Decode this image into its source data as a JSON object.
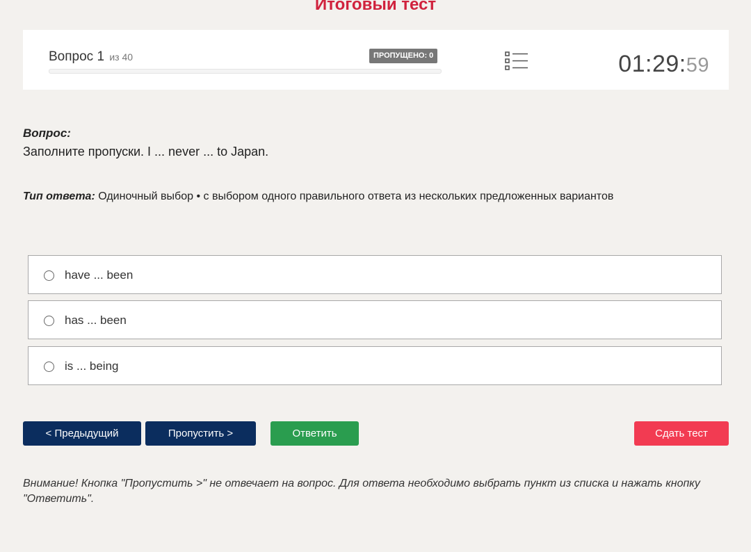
{
  "page": {
    "title": "Итоговый тест"
  },
  "header": {
    "question_word": "Вопрос",
    "question_number": "1",
    "of_total": "из 40",
    "skipped_badge": "ПРОПУЩЕНО: 0",
    "progress_fraction": 0,
    "list_icon": "list-icon",
    "timer_main": "01:29:",
    "timer_seconds": "59"
  },
  "question": {
    "label": "Вопрос:",
    "text": "Заполните пропуски. I ... never ... to Japan.",
    "answer_type_label": "Тип ответа:",
    "answer_type_text": "Одиночный выбор • с выбором одного правильного ответа из нескольких предложенных вариантов"
  },
  "options": [
    {
      "label": "have ... been",
      "selected": false
    },
    {
      "label": "has ... been",
      "selected": false
    },
    {
      "label": "is ... being",
      "selected": false
    }
  ],
  "buttons": {
    "prev": "< Предыдущий",
    "skip": "Пропустить >",
    "answer": "Ответить",
    "finish": "Сдать тест"
  },
  "notice": "Внимание! Кнопка \"Пропустить >\" не отвечает на вопрос. Для ответа необходимо выбрать пункт из списка и нажать кнопку \"Ответить\".",
  "colors": {
    "title": "#d0223d",
    "nav_button": "#0b2d5e",
    "answer_button": "#2a9d4f",
    "finish_button": "#f23b52",
    "background": "#f3f1ee"
  }
}
